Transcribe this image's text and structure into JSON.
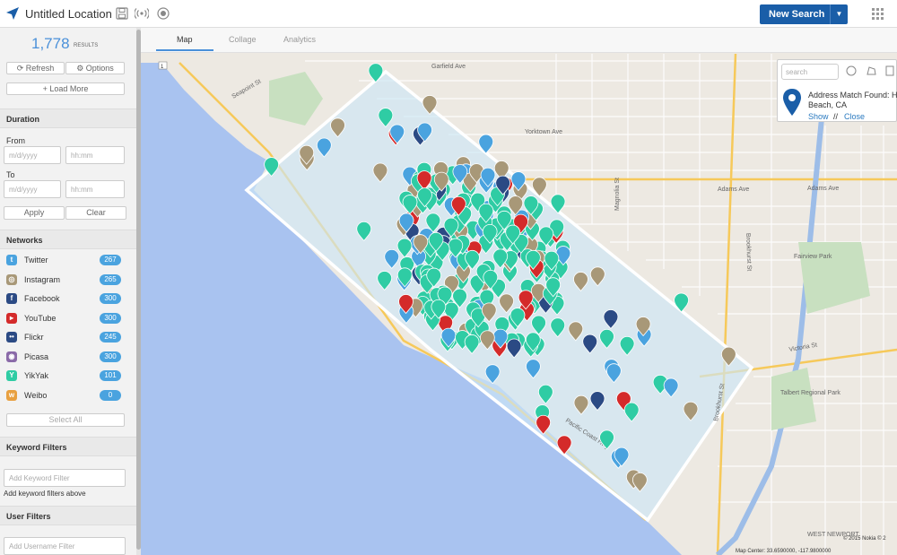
{
  "app": {
    "title": "Untitled Location",
    "new_search_label": "New Search"
  },
  "sidebar": {
    "result_count": "1,778",
    "result_label": "RESULTS",
    "refresh_label": "Refresh",
    "options_label": "Options",
    "load_more_label": "Load More",
    "duration": {
      "heading": "Duration",
      "from_label": "From",
      "to_label": "To",
      "date_placeholder": "m/d/yyyy",
      "time_placeholder": "hh:mm",
      "apply_label": "Apply",
      "clear_label": "Clear"
    },
    "networks_heading": "Networks",
    "networks": [
      {
        "name": "Twitter",
        "count": "267",
        "color": "#4aa3df",
        "glyph": "t"
      },
      {
        "name": "Instagram",
        "count": "265",
        "color": "#a89878",
        "glyph": "◎"
      },
      {
        "name": "Facebook",
        "count": "300",
        "color": "#2b4a84",
        "glyph": "f"
      },
      {
        "name": "YouTube",
        "count": "300",
        "color": "#d42a2a",
        "glyph": "▸"
      },
      {
        "name": "Flickr",
        "count": "245",
        "color": "#2b4a84",
        "glyph": "••"
      },
      {
        "name": "Picasa",
        "count": "300",
        "color": "#8a6aa8",
        "glyph": "◉"
      },
      {
        "name": "YikYak",
        "count": "101",
        "color": "#2fcca4",
        "glyph": "Y"
      },
      {
        "name": "Weibo",
        "count": "0",
        "color": "#e8a040",
        "glyph": "w"
      }
    ],
    "select_all_label": "Select All",
    "keyword_filters": {
      "heading": "Keyword Filters",
      "placeholder": "Add Keyword Filter",
      "hint": "Add keyword filters above"
    },
    "user_filters": {
      "heading": "User Filters",
      "placeholder": "Add Username Filter"
    }
  },
  "tabs": [
    {
      "label": "Map",
      "active": true
    },
    {
      "label": "Collage",
      "active": false
    },
    {
      "label": "Analytics",
      "active": false
    }
  ],
  "map_card": {
    "search_placeholder": "search",
    "address_line1": "Address Match Found: H",
    "address_line2": "Beach, CA",
    "show_label": "Show",
    "separator": "//",
    "close_label": "Close"
  },
  "map_labels": {
    "garfield": "Garfield Ave",
    "adams": "Adams Ave",
    "adams2": "Adams Ave",
    "victoria": "Victoria St",
    "pch": "Pacific Coast Hwy",
    "brookhurst": "Brookhurst St",
    "brookhurst2": "Brookhurst St",
    "magnolia": "Magnolia St",
    "yorktown": "Yorktown Ave",
    "fairview": "Fairview Park",
    "talbert": "Talbert Regional Park",
    "seapoint": "Seapoint St",
    "west_newport": "WEST NEWPORT",
    "route1": "1"
  },
  "copyright": "© 2015 Nokia  © 2",
  "scale": "Map Center: 33.6590000, -117.9800000"
}
